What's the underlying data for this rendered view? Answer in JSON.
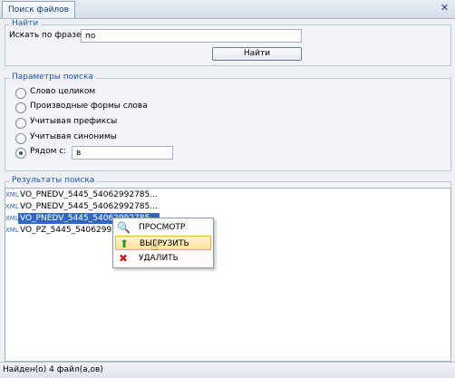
{
  "window": {
    "tab_title": "Поиск файлов",
    "close_label": "✕"
  },
  "find": {
    "group_title": "Найти",
    "phrase_label": "Искать по фразе:",
    "phrase_value": "по",
    "button_label": "Найти"
  },
  "params": {
    "group_title": "Параметры поиска",
    "options": [
      {
        "label": "Слово целиком",
        "checked": false
      },
      {
        "label": "Производные формы слова",
        "checked": false
      },
      {
        "label": "Учитывая префиксы",
        "checked": false
      },
      {
        "label": "Учитывая синонимы",
        "checked": false
      },
      {
        "label": "Рядом с:",
        "checked": true
      }
    ],
    "near_value": "в"
  },
  "results": {
    "group_title": "Результаты поиска",
    "badge": "XML",
    "files": [
      {
        "name": "VO_PNEDV_5445_54062992785...",
        "selected": false
      },
      {
        "name": "VO_PNEDV_5445_54062992785...",
        "selected": false
      },
      {
        "name": "VO_PNEDV_5445_54062992785...",
        "selected": true
      },
      {
        "name": "VO_PZ_5445_54062992785",
        "selected": false
      }
    ]
  },
  "context_menu": {
    "items": [
      {
        "label": "ПРОСМОТР",
        "icon": "preview-icon"
      },
      {
        "label": "ВЫГРУЗИТЬ",
        "icon": "export-icon",
        "hover": true
      },
      {
        "label": "УДАЛИТЬ",
        "icon": "delete-icon"
      }
    ]
  },
  "status": {
    "text": "Найден(о) 4 файл(а,ов)"
  }
}
